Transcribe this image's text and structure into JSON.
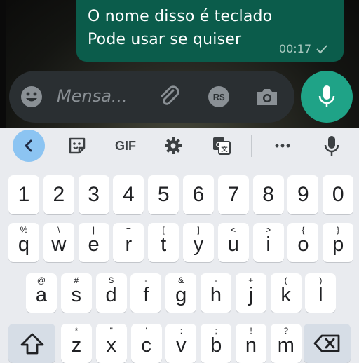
{
  "chat": {
    "message_line1": "O nome disso é teclado",
    "message_line2": "Pode usar se quiser",
    "message_time": "00:17",
    "input_placeholder": "Mensa..."
  },
  "keyboard": {
    "toolbar": [
      {
        "name": "back-chevron",
        "interactable": true
      },
      {
        "name": "sticker",
        "interactable": true
      },
      {
        "name": "gif",
        "label": "GIF",
        "interactable": true
      },
      {
        "name": "settings",
        "interactable": true
      },
      {
        "name": "translate",
        "interactable": true
      },
      {
        "name": "more",
        "interactable": true
      },
      {
        "name": "voice-input",
        "interactable": true
      }
    ],
    "numbers": [
      "1",
      "2",
      "3",
      "4",
      "5",
      "6",
      "7",
      "8",
      "9",
      "0"
    ],
    "row1": [
      {
        "key": "q",
        "hint": "%"
      },
      {
        "key": "w",
        "hint": "\\"
      },
      {
        "key": "e",
        "hint": "|"
      },
      {
        "key": "r",
        "hint": "="
      },
      {
        "key": "t",
        "hint": "["
      },
      {
        "key": "y",
        "hint": "]"
      },
      {
        "key": "u",
        "hint": "<"
      },
      {
        "key": "i",
        "hint": ">"
      },
      {
        "key": "o",
        "hint": "{"
      },
      {
        "key": "p",
        "hint": "}"
      }
    ],
    "row2": [
      {
        "key": "a",
        "hint": "@"
      },
      {
        "key": "s",
        "hint": "#"
      },
      {
        "key": "d",
        "hint": "$"
      },
      {
        "key": "f",
        "hint": "-"
      },
      {
        "key": "g",
        "hint": "&"
      },
      {
        "key": "h",
        "hint": "-"
      },
      {
        "key": "j",
        "hint": "+"
      },
      {
        "key": "k",
        "hint": "("
      },
      {
        "key": "l",
        "hint": ")"
      }
    ],
    "row3": [
      {
        "key": "z",
        "hint": "*"
      },
      {
        "key": "x",
        "hint": "\""
      },
      {
        "key": "c",
        "hint": "'"
      },
      {
        "key": "v",
        "hint": ":"
      },
      {
        "key": "b",
        "hint": ";"
      },
      {
        "key": "n",
        "hint": "!"
      },
      {
        "key": "m",
        "hint": "?"
      }
    ]
  },
  "colors": {
    "bubble": "#0b5c4b",
    "composer": "#2a2f32",
    "mic_button": "#1fa387",
    "keyboard_bg": "#e9ebef",
    "back_button": "#8cc4f2"
  }
}
